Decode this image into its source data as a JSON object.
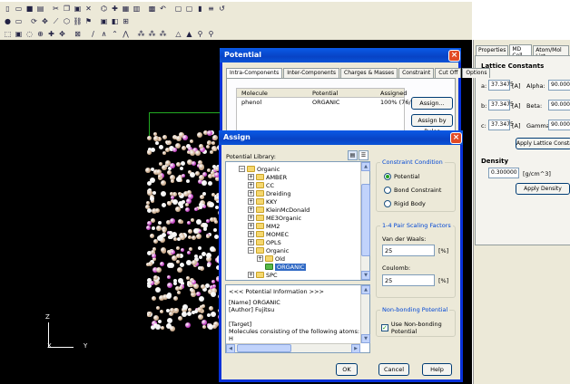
{
  "toolbar1": [
    "new-icon",
    "open-icon",
    "save-icon",
    "print-icon",
    "cut-icon",
    "copy-icon",
    "paste-icon",
    "delete-icon",
    "structure-icon",
    "axis-icon",
    "cell-icon",
    "table-icon",
    "grid-icon",
    "undo-icon",
    "window1-icon",
    "window2-icon",
    "chart-icon",
    "list-icon",
    "refresh-icon"
  ],
  "toolbar2": [
    "atom-icon",
    "measure-icon",
    "rotate-icon",
    "translate-icon",
    "bond-icon",
    "ring-icon",
    "chain-icon",
    "flag-icon",
    "image-icon",
    "palette-icon",
    "link-icon"
  ],
  "toolbar3": [
    "select-icon",
    "box-icon",
    "lasso-icon",
    "center-icon",
    "fit-icon",
    "pan-icon",
    "zoom-icon",
    "line-icon",
    "angle1-icon",
    "angle2-icon",
    "torsion-icon",
    "mol1-icon",
    "mol2-icon",
    "mol3-icon",
    "warn-icon",
    "marker-icon",
    "mag-icon",
    "magplus-icon"
  ],
  "axes": {
    "z": "Z",
    "x": "X",
    "y": "Y"
  },
  "right_panel": {
    "tabs": [
      "Properties",
      "MD Cell",
      "Atom/Mol List"
    ],
    "lattice_title": "Lattice Constants",
    "rows": [
      {
        "axis": "a:",
        "value": "37.3475",
        "unit": "[A]",
        "angle_label": "Alpha:",
        "angle": "90.0000"
      },
      {
        "axis": "b:",
        "value": "37.3475",
        "unit": "[A]",
        "angle_label": "Beta:",
        "angle": "90.0000"
      },
      {
        "axis": "c:",
        "value": "37.3475",
        "unit": "[A]",
        "angle_label": "Gamma:",
        "angle": "90.0000"
      }
    ],
    "apply_lattice": "Apply Lattice Constan",
    "density_title": "Density",
    "density_value": "0.300000",
    "density_unit": "[g/cm^3]",
    "apply_density": "Apply Density"
  },
  "potential": {
    "title": "Potential",
    "tabs": [
      "Intra-Components",
      "Inter-Components",
      "Charges & Masses",
      "Constraint",
      "Cut Off",
      "Options"
    ],
    "columns": [
      "Molecule",
      "Potential",
      "Assigned"
    ],
    "rows": [
      {
        "molecule": "phenol",
        "potential": "ORGANIC",
        "assigned": "100% (76/"
      }
    ],
    "assign_button": "Assign...",
    "assign_rules_button": "Assign by Rules"
  },
  "assign": {
    "title": "Assign",
    "library_label": "Potential Library:",
    "tree": [
      {
        "label": "Organic",
        "level": 0,
        "expander": "−"
      },
      {
        "label": "AMBER",
        "level": 1,
        "expander": "+"
      },
      {
        "label": "CC",
        "level": 1,
        "expander": "+"
      },
      {
        "label": "Dreiding",
        "level": 1,
        "expander": "+"
      },
      {
        "label": "KKY",
        "level": 1,
        "expander": "+"
      },
      {
        "label": "KleinMcDonald",
        "level": 1,
        "expander": "+"
      },
      {
        "label": "ME3Organic",
        "level": 1,
        "expander": "+"
      },
      {
        "label": "MM2",
        "level": 1,
        "expander": "+"
      },
      {
        "label": "MOMEC",
        "level": 1,
        "expander": "+"
      },
      {
        "label": "OPLS",
        "level": 1,
        "expander": "+"
      },
      {
        "label": "Organic",
        "level": 1,
        "expander": "−"
      },
      {
        "label": "Old",
        "level": 2,
        "expander": "+"
      },
      {
        "label": "ORGANIC",
        "level": 2,
        "expander": "",
        "selected": true
      },
      {
        "label": "SPC",
        "level": 1,
        "expander": "+"
      }
    ],
    "info_header": "<<< Potential Information >>>",
    "info_lines": [
      "[Name] ORGANIC",
      "[Author] Fujitsu",
      "",
      "[Target]",
      "Molecules consisting of the following atoms:",
      "H"
    ],
    "constraint_title": "Constraint Condition",
    "constraint_options": [
      {
        "label": "Potential",
        "selected": true
      },
      {
        "label": "Bond Constraint",
        "selected": false
      },
      {
        "label": "Rigid Body",
        "selected": false
      }
    ],
    "scaling_title": "1-4 Pair Scaling Factors",
    "vdw_label": "Van der Waals:",
    "vdw_value": "25",
    "vdw_unit": "[%]",
    "coulomb_label": "Coulomb:",
    "coulomb_value": "25",
    "coulomb_unit": "[%]",
    "nonbond_title": "Non-bonding Potential",
    "nonbond_label": "Use Non-bonding Potential",
    "ok": "OK",
    "cancel": "Cancel",
    "help": "Help"
  }
}
